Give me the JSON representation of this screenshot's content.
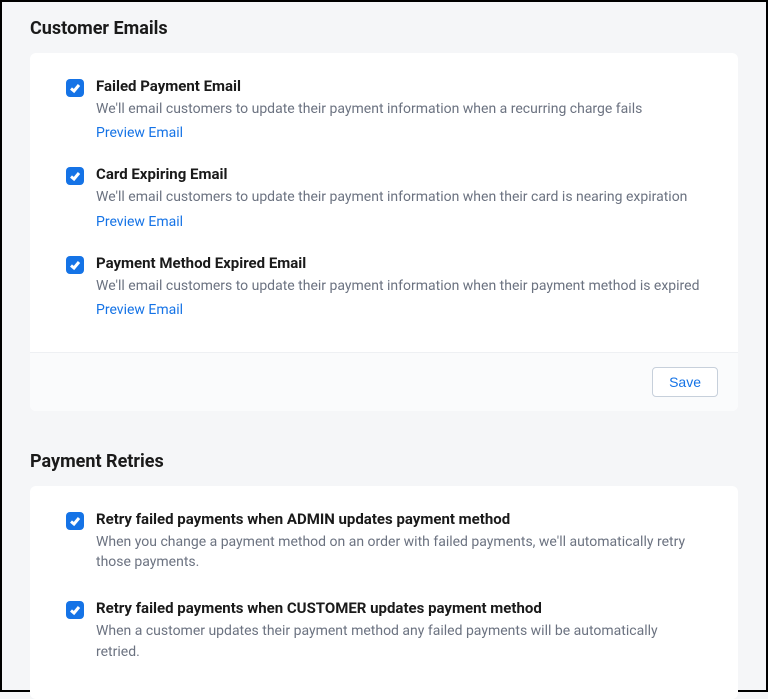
{
  "sections": {
    "customer_emails": {
      "title": "Customer Emails",
      "save_label": "Save",
      "options": [
        {
          "title": "Failed Payment Email",
          "description": "We'll email customers to update their payment information when a recurring charge fails",
          "preview_label": "Preview Email",
          "checked": true
        },
        {
          "title": "Card Expiring Email",
          "description": "We'll email customers to update their payment information when their card is nearing expiration",
          "preview_label": "Preview Email",
          "checked": true
        },
        {
          "title": "Payment Method Expired Email",
          "description": "We'll email customers to update their payment information when their payment method is expired",
          "preview_label": "Preview Email",
          "checked": true
        }
      ]
    },
    "payment_retries": {
      "title": "Payment Retries",
      "options": [
        {
          "title": "Retry failed payments when ADMIN updates payment method",
          "description": "When you change a payment method on an order with failed payments, we'll automatically retry those payments.",
          "checked": true
        },
        {
          "title": "Retry failed payments when CUSTOMER updates payment method",
          "description": "When a customer updates their payment method any failed payments will be automatically retried.",
          "checked": true
        }
      ]
    }
  }
}
